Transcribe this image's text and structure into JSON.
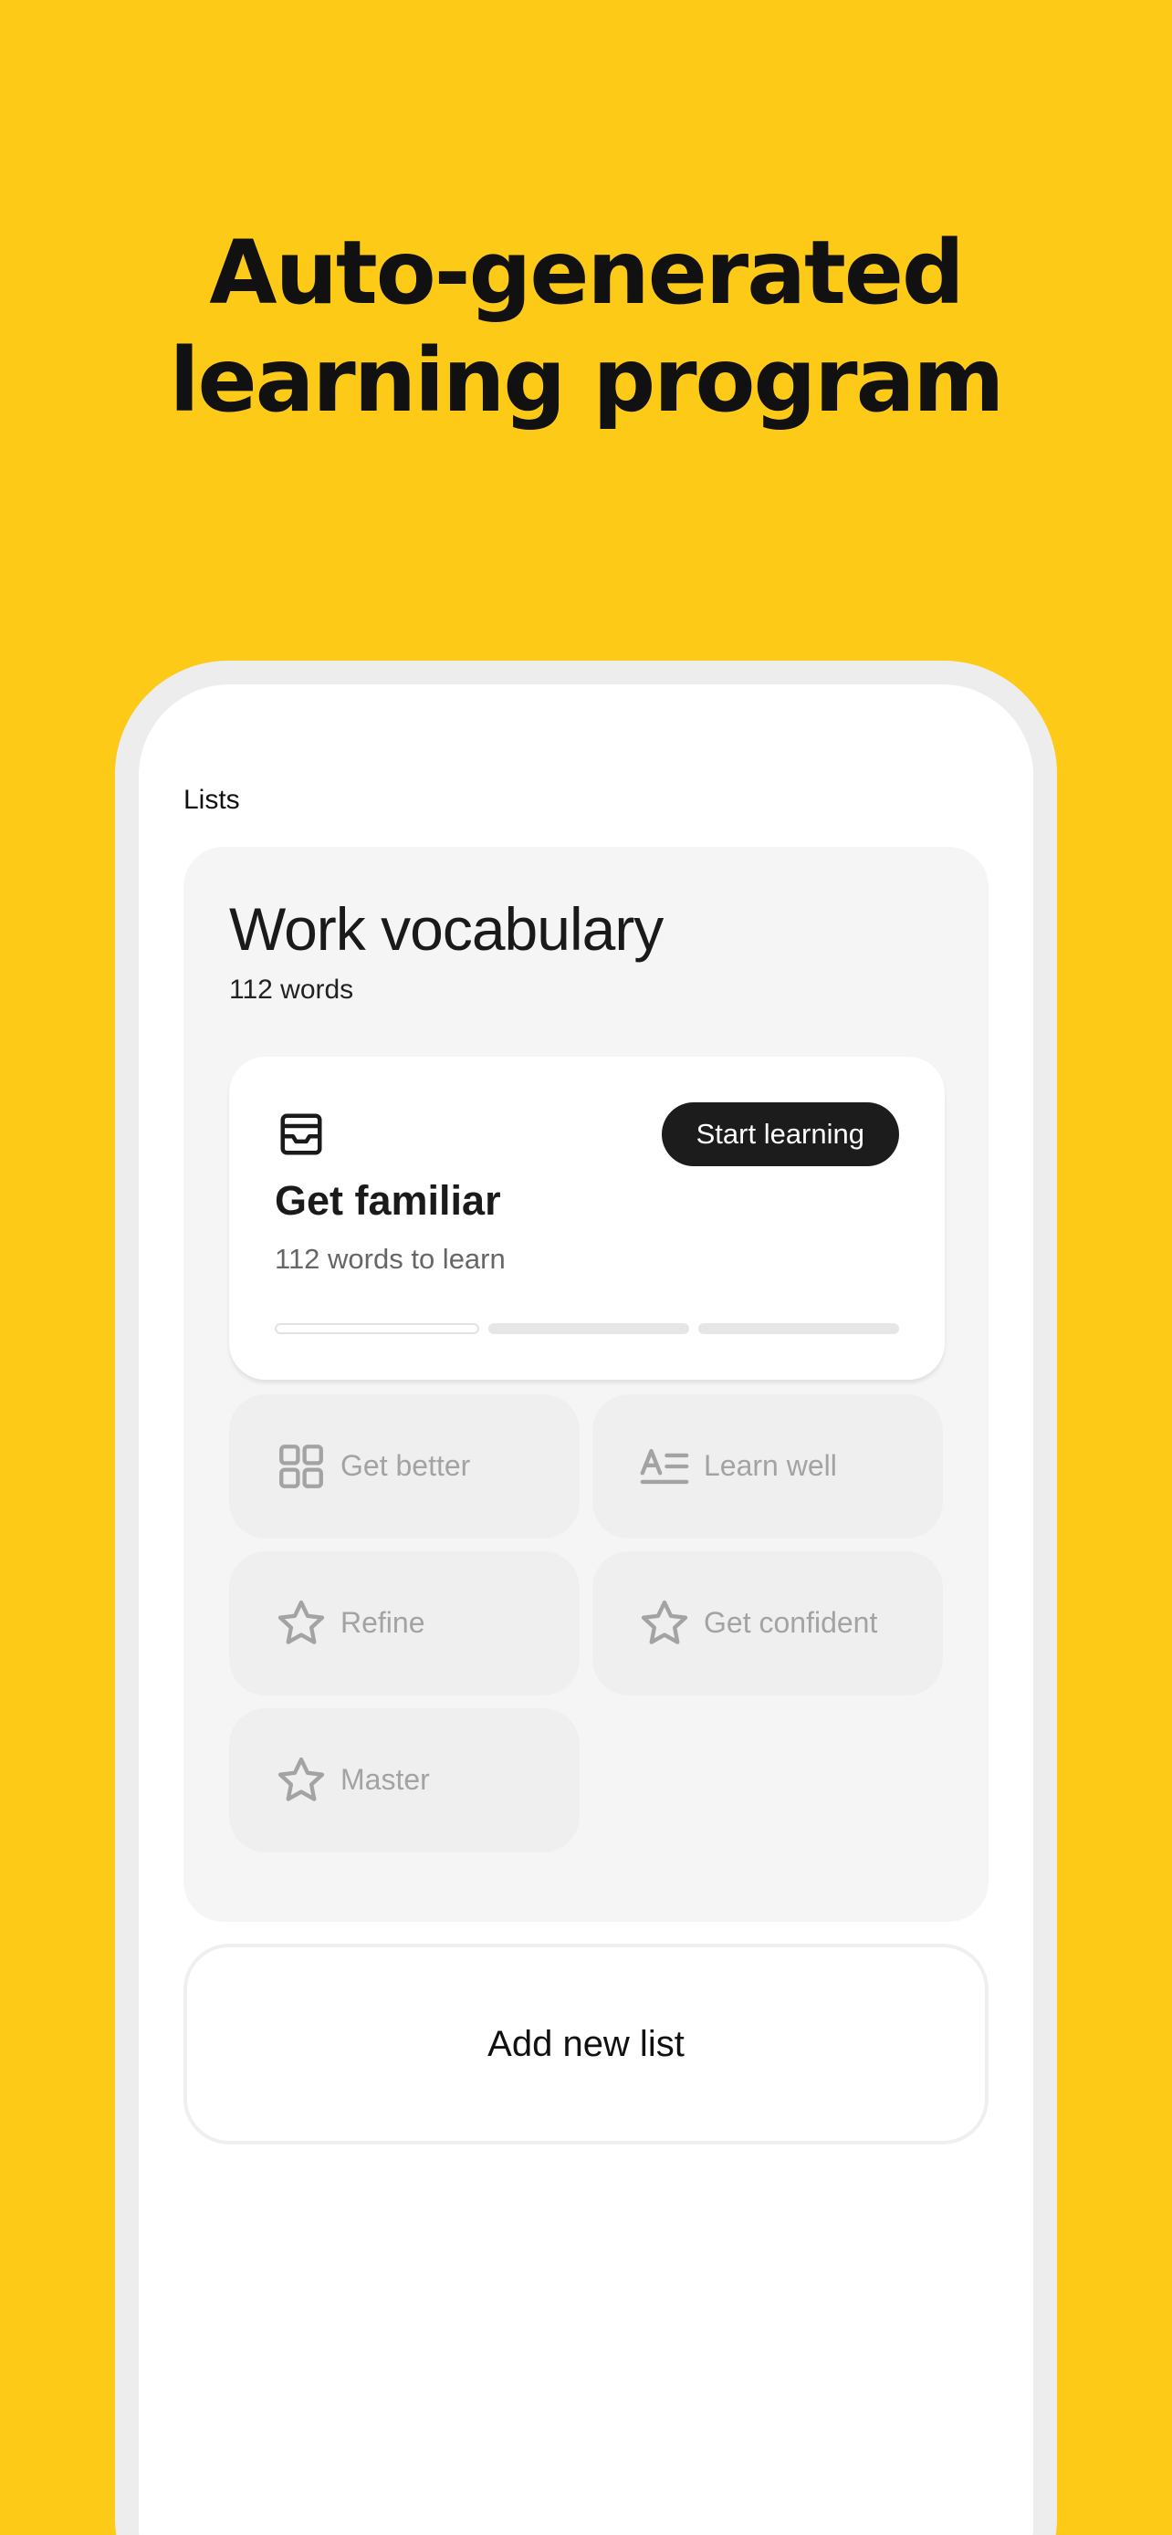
{
  "headline": {
    "line1": "Auto-generated",
    "line2": "learning program"
  },
  "lists_label": "Lists",
  "list": {
    "title": "Work vocabulary",
    "count": "112 words",
    "active_stage": {
      "icon": "inbox-icon",
      "title": "Get familiar",
      "subtitle": "112 words to learn",
      "button": "Start learning",
      "progress_segments": 3
    },
    "stages": [
      {
        "label": "Get better",
        "icon": "grid-icon"
      },
      {
        "label": "Learn well",
        "icon": "text-lines-icon"
      },
      {
        "label": "Refine",
        "icon": "star-icon"
      },
      {
        "label": "Get confident",
        "icon": "star-icon"
      },
      {
        "label": "Master",
        "icon": "star-icon"
      }
    ]
  },
  "add_list_button": "Add new list",
  "colors": {
    "background": "#FDCA17",
    "button_dark": "#1C1C1C",
    "card": "#F5F5F5",
    "tile": "#EFEFEF",
    "muted_text": "#A3A3A3"
  }
}
